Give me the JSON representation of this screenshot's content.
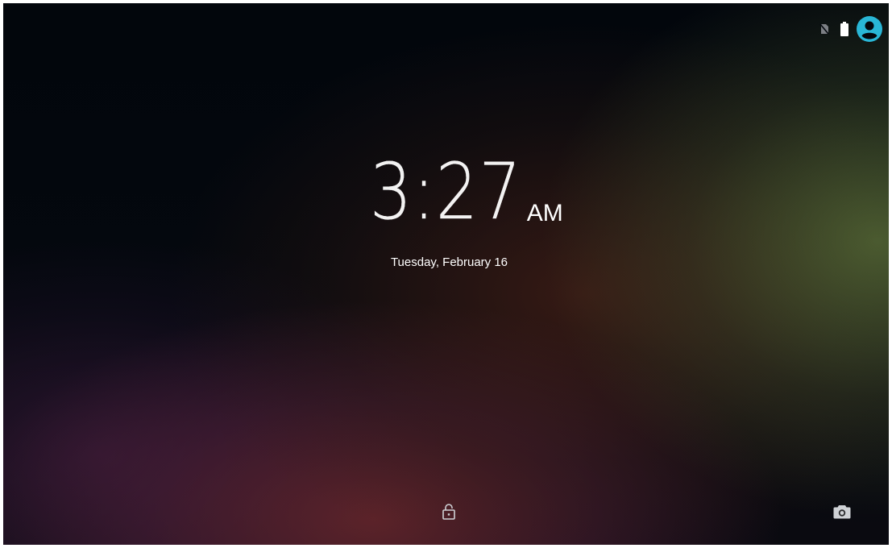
{
  "status_bar": {
    "sim_icon": "no-sim-icon",
    "battery_icon": "battery-full-icon",
    "user_icon": "user-account-icon"
  },
  "lockscreen": {
    "time": "3:27",
    "ampm": "AM",
    "date": "Tuesday, February 16"
  },
  "actions": {
    "unlock_icon": "unlock-icon",
    "camera_icon": "camera-icon"
  },
  "colors": {
    "accent": "#29b6d6",
    "text": "#ffffff",
    "background": "#03070d"
  }
}
